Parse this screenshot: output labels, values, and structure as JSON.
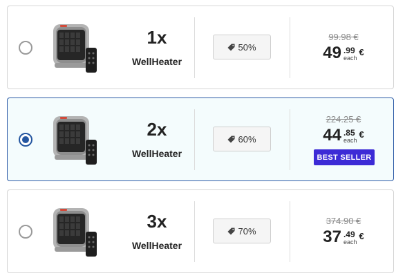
{
  "offers": [
    {
      "quantity": "1x",
      "product_name": "WellHeater",
      "discount": "50%",
      "old_price": "99.98 €",
      "price_int": "49",
      "price_cents": ".99",
      "price_each": "each",
      "currency": "€",
      "badge": "",
      "selected": false
    },
    {
      "quantity": "2x",
      "product_name": "WellHeater",
      "discount": "60%",
      "old_price": "224.25 €",
      "price_int": "44",
      "price_cents": ".85",
      "price_each": "each",
      "currency": "€",
      "badge": "BEST SELLER",
      "selected": true
    },
    {
      "quantity": "3x",
      "product_name": "WellHeater",
      "discount": "70%",
      "old_price": "374.90 €",
      "price_int": "37",
      "price_cents": ".49",
      "price_each": "each",
      "currency": "€",
      "badge": "",
      "selected": false
    }
  ],
  "colors": {
    "selected_border": "#2b59a6",
    "selected_bg": "#f4fcfd",
    "radio_selected": "#2456a0",
    "badge_bg": "#3c2bd6"
  },
  "icons": {
    "discount": "tag-icon",
    "product": "heater-with-remote-image"
  }
}
